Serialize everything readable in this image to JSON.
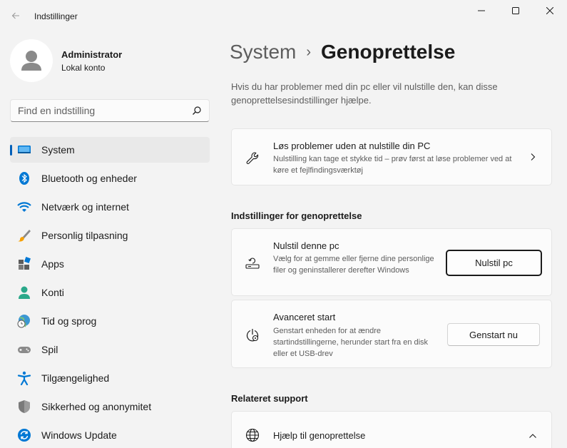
{
  "window": {
    "app_title": "Indstillinger",
    "back_icon": "back-arrow-icon",
    "controls": [
      "minimize-icon",
      "maximize-icon",
      "close-icon"
    ]
  },
  "profile": {
    "name": "Administrator",
    "account_type": "Lokal konto"
  },
  "search": {
    "placeholder": "Find en indstilling",
    "value": ""
  },
  "sidebar": {
    "items": [
      {
        "label": "System",
        "icon": "system-icon",
        "active": true
      },
      {
        "label": "Bluetooth og enheder",
        "icon": "bluetooth-icon"
      },
      {
        "label": "Netværk og internet",
        "icon": "wifi-icon"
      },
      {
        "label": "Personlig tilpasning",
        "icon": "brush-icon"
      },
      {
        "label": "Apps",
        "icon": "apps-icon"
      },
      {
        "label": "Konti",
        "icon": "account-icon"
      },
      {
        "label": "Tid og sprog",
        "icon": "time-language-icon"
      },
      {
        "label": "Spil",
        "icon": "gaming-icon"
      },
      {
        "label": "Tilgængelighed",
        "icon": "accessibility-icon"
      },
      {
        "label": "Sikkerhed og anonymitet",
        "icon": "shield-icon"
      },
      {
        "label": "Windows Update",
        "icon": "windows-update-icon"
      }
    ]
  },
  "header": {
    "parent": "System",
    "separator": "›",
    "current": "Genoprettelse"
  },
  "intro": "Hvis du har problemer med din pc eller vil nulstille den, kan disse genoprettelsesindstillinger hjælpe.",
  "troubleshoot_card": {
    "title": "Løs problemer uden at nulstille din PC",
    "description": "Nulstilling kan tage et stykke tid – prøv først at løse problemer ved at køre et fejlfindingsværktøj",
    "icon": "wrench-icon"
  },
  "recovery_section": {
    "header": "Indstillinger for genoprettelse",
    "reset": {
      "title": "Nulstil denne pc",
      "description": "Vælg for at gemme eller fjerne dine personlige filer og geninstallerer derefter Windows",
      "button": "Nulstil pc",
      "icon": "reset-pc-icon"
    },
    "advanced": {
      "title": "Avanceret start",
      "description": "Genstart enheden for at ændre startindstillingerne, herunder start fra en disk eller et USB-drev",
      "button": "Genstart nu",
      "icon": "advanced-startup-icon"
    }
  },
  "related_section": {
    "header": "Relateret support",
    "help": {
      "title": "Hjælp til genoprettelse",
      "icon": "globe-icon"
    }
  }
}
